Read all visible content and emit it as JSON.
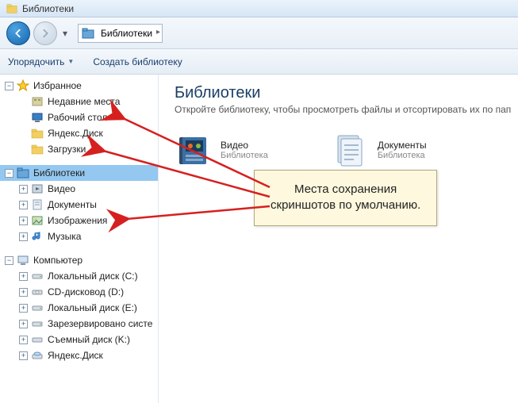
{
  "window": {
    "title": "Библиотеки"
  },
  "address": {
    "segments": [
      "Библиотеки"
    ]
  },
  "toolbar": {
    "organize": "Упорядочить",
    "create_library": "Создать библиотеку"
  },
  "sidebar": {
    "favorites": {
      "label": "Избранное",
      "items": [
        {
          "label": "Недавние места"
        },
        {
          "label": "Рабочий стол"
        },
        {
          "label": "Яндекс.Диск"
        },
        {
          "label": "Загрузки"
        }
      ]
    },
    "libraries": {
      "label": "Библиотеки",
      "items": [
        {
          "label": "Видео"
        },
        {
          "label": "Документы"
        },
        {
          "label": "Изображения"
        },
        {
          "label": "Музыка"
        }
      ]
    },
    "computer": {
      "label": "Компьютер",
      "items": [
        {
          "label": "Локальный диск (C:)"
        },
        {
          "label": "CD-дисковод (D:)"
        },
        {
          "label": "Локальный диск (E:)"
        },
        {
          "label": "Зарезервировано систе"
        },
        {
          "label": "Съемный диск (K:)"
        },
        {
          "label": "Яндекс.Диск"
        }
      ]
    }
  },
  "content": {
    "heading": "Библиотеки",
    "subtitle": "Откройте библиотеку, чтобы просмотреть файлы и отсортировать их по пап",
    "libraries": [
      {
        "name": "Видео",
        "sub": "Библиотека"
      },
      {
        "name": "Документы",
        "sub": "Библиотека"
      }
    ]
  },
  "callout": {
    "line1": "Места сохранения",
    "line2": "скриншотов по умолчанию."
  }
}
